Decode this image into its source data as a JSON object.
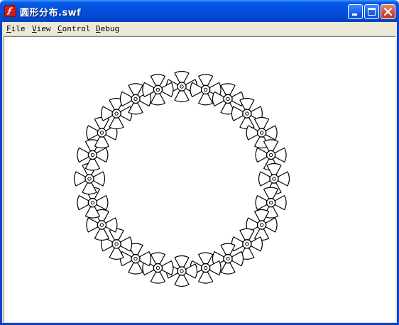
{
  "window": {
    "title": "圆形分布.swf",
    "app_icon": "flash-player-icon"
  },
  "title_buttons": [
    "minimize-icon",
    "maximize-icon",
    "close-icon"
  ],
  "menu": {
    "items": [
      {
        "label_first": "F",
        "label_rest": "ile"
      },
      {
        "label_first": "V",
        "label_rest": "iew"
      },
      {
        "label_first": "C",
        "label_rest": "ontrol"
      },
      {
        "label_first": "D",
        "label_rest": "ebug"
      }
    ]
  },
  "stage": {
    "background": "#ffffff",
    "shape_stroke": "#000000",
    "shape_count": 24,
    "shape_icon": "fan-icon"
  }
}
